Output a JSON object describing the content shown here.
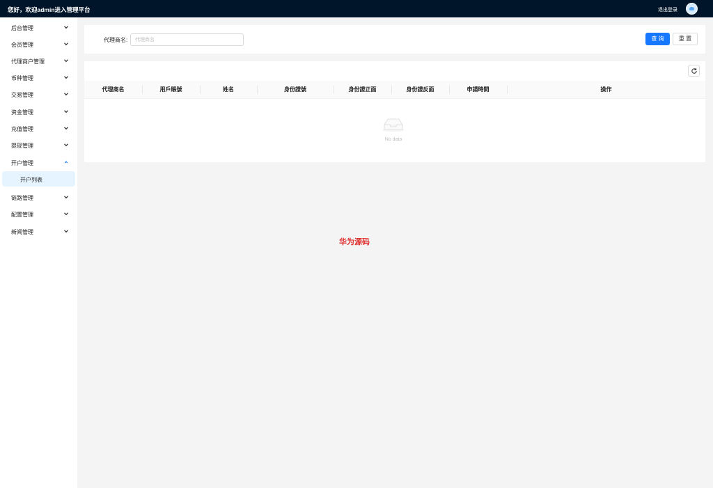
{
  "header": {
    "welcome": "您好，欢迎admin进入管理平台",
    "logout_label": "退出登录"
  },
  "sidebar": {
    "items": [
      {
        "label": "后台管理",
        "expanded": false
      },
      {
        "label": "会员管理",
        "expanded": false
      },
      {
        "label": "代理商户管理",
        "expanded": false
      },
      {
        "label": "币种管理",
        "expanded": false
      },
      {
        "label": "交易管理",
        "expanded": false
      },
      {
        "label": "资金管理",
        "expanded": false
      },
      {
        "label": "充值管理",
        "expanded": false
      },
      {
        "label": "提现管理",
        "expanded": false
      },
      {
        "label": "开户管理",
        "expanded": true
      },
      {
        "label": "链路管理",
        "expanded": false
      },
      {
        "label": "配置管理",
        "expanded": false
      },
      {
        "label": "新闻管理",
        "expanded": false
      }
    ],
    "active_sub_item": "开户列表"
  },
  "filter": {
    "label": "代理商名:",
    "value": "",
    "placeholder": "代理商名",
    "query_label": "查 询",
    "reset_label": "重 置"
  },
  "table": {
    "columns": [
      "代理商名",
      "用戶賬號",
      "姓名",
      "身份證號",
      "身份證正面",
      "身份證反面",
      "申請時間",
      "操作"
    ],
    "rows": [],
    "empty_text": "No data"
  },
  "watermark": "华为源码",
  "colors": {
    "header_bg": "#001529",
    "primary": "#1677ff",
    "active_menu_bg": "#e6f4ff",
    "watermark": "#e03030"
  }
}
